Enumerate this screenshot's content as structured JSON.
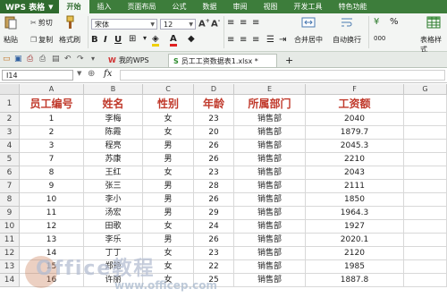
{
  "app": {
    "name": "WPS 表格"
  },
  "ribbon_tabs": [
    "开始",
    "插入",
    "页面布局",
    "公式",
    "数据",
    "审阅",
    "视图",
    "开发工具",
    "特色功能"
  ],
  "ribbon": {
    "paste": "粘贴",
    "cut": "剪切",
    "copy": "复制",
    "format_painter": "格式刷",
    "font_name": "宋体",
    "font_size": "12",
    "merge_center": "合并居中",
    "wrap_text": "自动换行",
    "table_style": "表格样式",
    "percent": "%",
    "comma": "000"
  },
  "doc_tabs": [
    {
      "label": "我的WPS"
    },
    {
      "label": "员工工资数据表1.xlsx *"
    }
  ],
  "new_tab": "+",
  "formula_bar": {
    "cell_ref": "I14",
    "fx": "fx",
    "value": ""
  },
  "columns": [
    "A",
    "B",
    "C",
    "D",
    "E",
    "F",
    "G"
  ],
  "headers": [
    "员工编号",
    "姓名",
    "性别",
    "年龄",
    "所属部门",
    "工资额"
  ],
  "rows": [
    [
      "1",
      "李梅",
      "女",
      "23",
      "销售部",
      "2040"
    ],
    [
      "2",
      "陈霞",
      "女",
      "20",
      "销售部",
      "1879.7"
    ],
    [
      "3",
      "程亮",
      "男",
      "26",
      "销售部",
      "2045.3"
    ],
    [
      "7",
      "苏康",
      "男",
      "26",
      "销售部",
      "2210"
    ],
    [
      "8",
      "王红",
      "女",
      "23",
      "销售部",
      "2043"
    ],
    [
      "9",
      "张三",
      "男",
      "28",
      "销售部",
      "2111"
    ],
    [
      "10",
      "李小",
      "男",
      "26",
      "销售部",
      "1850"
    ],
    [
      "11",
      "汤宏",
      "男",
      "29",
      "销售部",
      "1964.3"
    ],
    [
      "12",
      "田歌",
      "女",
      "24",
      "销售部",
      "1927"
    ],
    [
      "13",
      "李乐",
      "男",
      "26",
      "销售部",
      "2020.1"
    ],
    [
      "14",
      "丁丁",
      "女",
      "23",
      "销售部",
      "2120"
    ],
    [
      "15",
      "郑艳",
      "女",
      "22",
      "销售部",
      "1985"
    ],
    [
      "16",
      "许丽",
      "女",
      "25",
      "销售部",
      "1887.8"
    ]
  ],
  "row_numbers": [
    "1",
    "2",
    "3",
    "4",
    "5",
    "6",
    "7",
    "8",
    "9",
    "10",
    "11",
    "12",
    "13",
    "14"
  ],
  "watermark": {
    "brand": "Office教程",
    "url": "www.officep.com"
  }
}
